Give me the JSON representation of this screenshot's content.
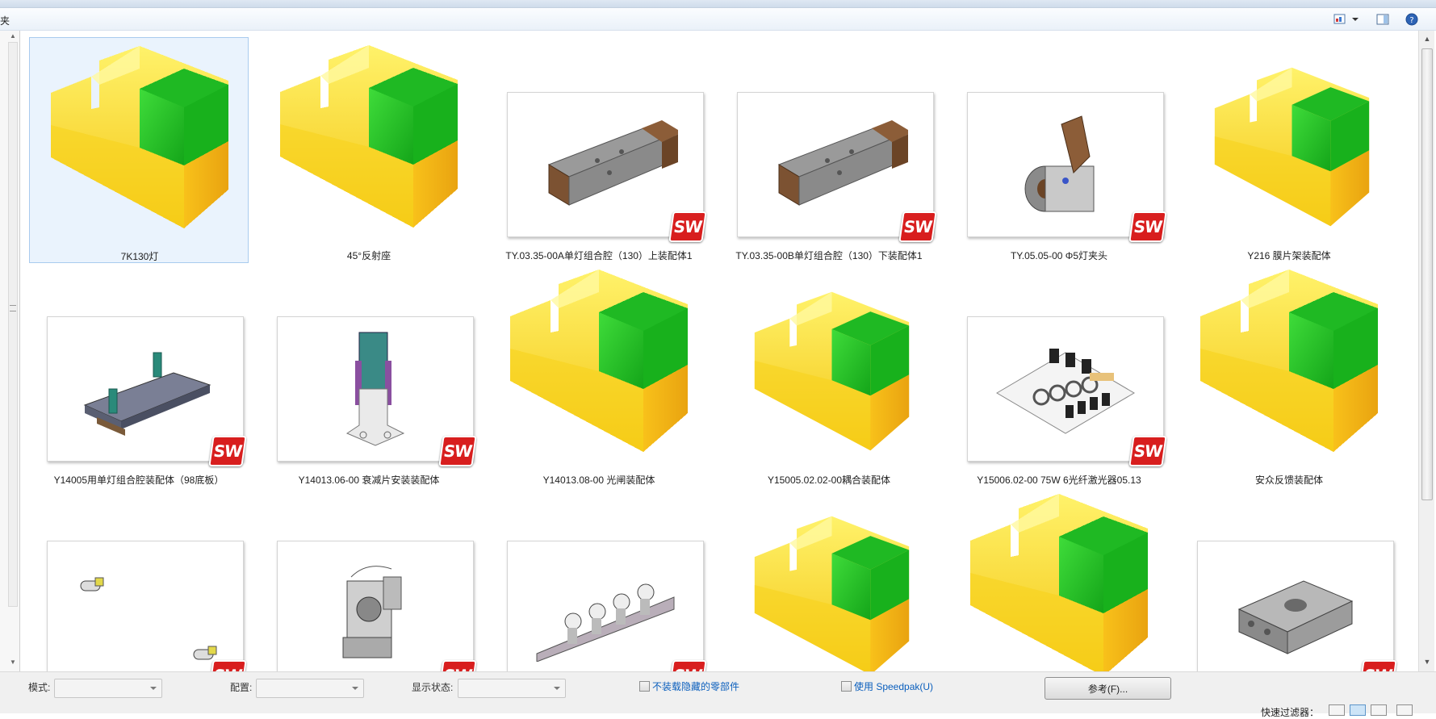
{
  "header": {
    "title": "夹"
  },
  "items": [
    {
      "label": "7K130灯",
      "kind": "generic",
      "selected": true
    },
    {
      "label": "45°反射座",
      "kind": "generic",
      "selected": false
    },
    {
      "label": "TY.03.35-00A单灯组合腔（130）上装配体1",
      "kind": "sw-block",
      "selected": false
    },
    {
      "label": "TY.03.35-00B单灯组合腔（130）下装配体1",
      "kind": "sw-block",
      "selected": false
    },
    {
      "label": "TY.05.05-00 Φ5灯夹头",
      "kind": "sw-clamp",
      "selected": false
    },
    {
      "label": "Y216 膜片架装配体",
      "kind": "generic-small",
      "selected": false
    },
    {
      "label": "Y14005用单灯组合腔装配体（98底板）",
      "kind": "sw-plate",
      "selected": false
    },
    {
      "label": "Y14013.06-00 衰减片安装装配体",
      "kind": "sw-bracket",
      "selected": false
    },
    {
      "label": "Y14013.08-00 光闸装配体",
      "kind": "generic",
      "selected": false
    },
    {
      "label": "Y15005.02.02-00耦合装配体",
      "kind": "generic-small",
      "selected": false
    },
    {
      "label": "Y15006.02-00 75W 6光纤激光器05.13",
      "kind": "sw-board",
      "selected": false
    },
    {
      "label": "安众反馈装配体",
      "kind": "generic",
      "selected": false
    },
    {
      "label": "",
      "kind": "sw-tiny",
      "selected": false
    },
    {
      "label": "",
      "kind": "sw-frame",
      "selected": false
    },
    {
      "label": "",
      "kind": "sw-rail",
      "selected": false
    },
    {
      "label": "",
      "kind": "generic-small",
      "selected": false
    },
    {
      "label": "",
      "kind": "generic",
      "selected": false
    },
    {
      "label": "",
      "kind": "sw-part",
      "selected": false
    }
  ],
  "sw_badge_text": "SW",
  "options": {
    "mode_label": "模式:",
    "config_label": "配置:",
    "display_state_label": "显示状态:",
    "hide_parts_label": "不装载隐藏的零部件",
    "speedpak_label": "使用 Speedpak(U)",
    "reference_button": "参考(F)...",
    "quick_filter_label": "快速过滤器："
  },
  "colors": {
    "accent": "#0b5fbd",
    "selection": "#eaf3fd",
    "sw_red": "#d81e1e",
    "block_yellow": "#f7d21a",
    "block_green": "#1fb923"
  }
}
